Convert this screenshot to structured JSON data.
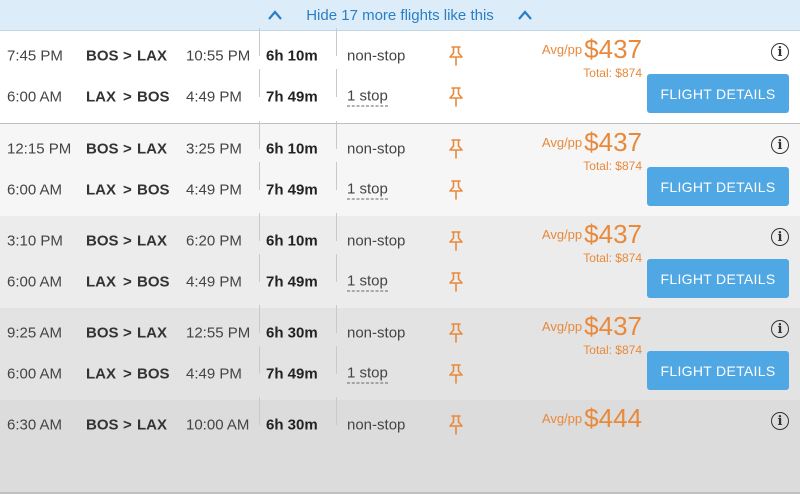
{
  "hide_bar": {
    "label": "Hide 17 more flights like this"
  },
  "details_label": "FLIGHT DETAILS",
  "avg_label": "Avg/pp",
  "cards": [
    {
      "price": "$437",
      "total": "Total: $874",
      "legs": [
        {
          "depart": "7:45 PM",
          "from": "BOS",
          "arrow": ">",
          "to": "LAX",
          "arrive": "10:55 PM",
          "duration": "6h 10m",
          "stops": "non-stop"
        },
        {
          "depart": "6:00 AM",
          "from": "LAX",
          "arrow": ">",
          "to": "BOS",
          "arrive": "4:49 PM",
          "duration": "7h 49m",
          "stops": "1 stop"
        }
      ]
    },
    {
      "price": "$437",
      "total": "Total: $874",
      "legs": [
        {
          "depart": "12:15 PM",
          "from": "BOS",
          "arrow": ">",
          "to": "LAX",
          "arrive": "3:25 PM",
          "duration": "6h 10m",
          "stops": "non-stop"
        },
        {
          "depart": "6:00 AM",
          "from": "LAX",
          "arrow": ">",
          "to": "BOS",
          "arrive": "4:49 PM",
          "duration": "7h 49m",
          "stops": "1 stop"
        }
      ]
    },
    {
      "price": "$437",
      "total": "Total: $874",
      "legs": [
        {
          "depart": "3:10 PM",
          "from": "BOS",
          "arrow": ">",
          "to": "LAX",
          "arrive": "6:20 PM",
          "duration": "6h 10m",
          "stops": "non-stop"
        },
        {
          "depart": "6:00 AM",
          "from": "LAX",
          "arrow": ">",
          "to": "BOS",
          "arrive": "4:49 PM",
          "duration": "7h 49m",
          "stops": "1 stop"
        }
      ]
    },
    {
      "price": "$437",
      "total": "Total: $874",
      "legs": [
        {
          "depart": "9:25 AM",
          "from": "BOS",
          "arrow": ">",
          "to": "LAX",
          "arrive": "12:55 PM",
          "duration": "6h 30m",
          "stops": "non-stop"
        },
        {
          "depart": "6:00 AM",
          "from": "LAX",
          "arrow": ">",
          "to": "BOS",
          "arrive": "4:49 PM",
          "duration": "7h 49m",
          "stops": "1 stop"
        }
      ]
    },
    {
      "price": "$444",
      "total": "",
      "legs": [
        {
          "depart": "6:30 AM",
          "from": "BOS",
          "arrow": ">",
          "to": "LAX",
          "arrive": "10:00 AM",
          "duration": "6h 30m",
          "stops": "non-stop"
        }
      ]
    }
  ]
}
